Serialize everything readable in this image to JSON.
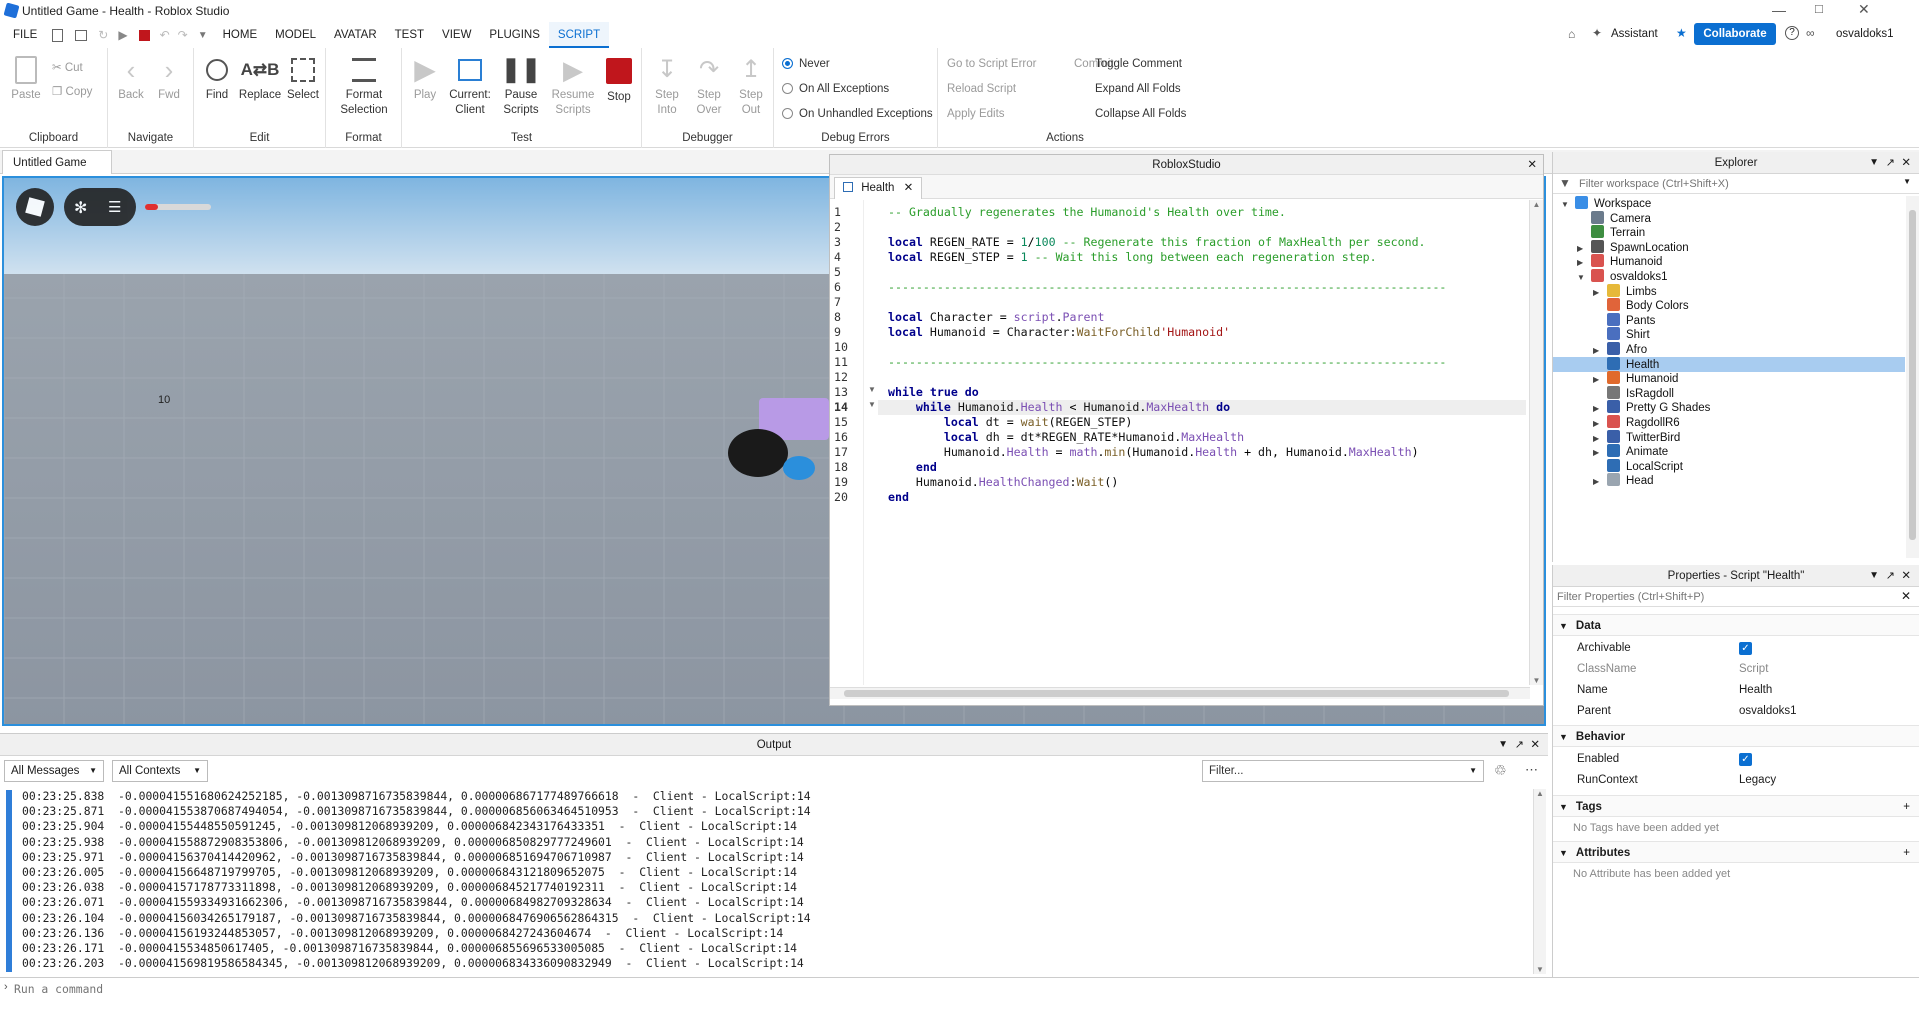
{
  "window": {
    "title": "Untitled Game - Health - Roblox Studio"
  },
  "menubar": {
    "items": [
      "FILE",
      "HOME",
      "MODEL",
      "AVATAR",
      "TEST",
      "VIEW",
      "PLUGINS",
      "SCRIPT"
    ],
    "active": "SCRIPT",
    "assistant": "Assistant",
    "collaborate": "Collaborate",
    "user": "osvaldoks1"
  },
  "ribbon": {
    "clipboard": {
      "label": "Clipboard",
      "paste": "Paste",
      "cut": "Cut",
      "copy": "Copy"
    },
    "navigate": {
      "label": "Navigate",
      "back": "Back",
      "fwd": "Fwd"
    },
    "edit": {
      "label": "Edit",
      "find": "Find",
      "replace": "Replace",
      "select": "Select"
    },
    "format": {
      "label": "Format",
      "format_selection_1": "Format",
      "format_selection_2": "Selection"
    },
    "test": {
      "label": "Test",
      "play": "Play",
      "current_1": "Current:",
      "current_2": "Client",
      "pause_1": "Pause",
      "pause_2": "Scripts",
      "resume_1": "Resume",
      "resume_2": "Scripts",
      "stop": "Stop"
    },
    "debugger": {
      "label": "Debugger",
      "step_into_1": "Step",
      "step_into_2": "Into",
      "step_over_1": "Step",
      "step_over_2": "Over",
      "step_out_1": "Step",
      "step_out_2": "Out"
    },
    "debug_errors": {
      "label": "Debug Errors",
      "never": "Never",
      "on_all": "On All Exceptions",
      "on_unhandled": "On Unhandled Exceptions",
      "selected": "Never"
    },
    "actions": {
      "label": "Actions",
      "go_to_error": "Go to Script Error",
      "commit": "Commit",
      "reload": "Reload Script",
      "apply": "Apply Edits",
      "toggle_comment": "Toggle Comment",
      "expand": "Expand All Folds",
      "collapse": "Collapse All Folds"
    }
  },
  "doc_tabs": {
    "game_tab": "Untitled Game"
  },
  "viewport": {
    "floating_number": "10",
    "health_fill": 0.2
  },
  "editor": {
    "window_title": "RobloxStudio",
    "tab": "Health",
    "lines": [
      "-- Gradually regenerates the Humanoid's Health over time.",
      "",
      "local REGEN_RATE = 1/100 -- Regenerate this fraction of MaxHealth per second.",
      "local REGEN_STEP = 1 -- Wait this long between each regeneration step.",
      "",
      "--------------------------------------------------------------------------------",
      "",
      "local Character = script.Parent",
      "local Humanoid = Character:WaitForChild'Humanoid'",
      "",
      "--------------------------------------------------------------------------------",
      "",
      "while true do",
      "    while Humanoid.Health < Humanoid.MaxHealth do",
      "        local dt = wait(REGEN_STEP)",
      "        local dh = dt*REGEN_RATE*Humanoid.MaxHealth",
      "        Humanoid.Health = math.min(Humanoid.Health + dh, Humanoid.MaxHealth)",
      "    end",
      "    Humanoid.HealthChanged:Wait()",
      "end"
    ],
    "current_line": 14
  },
  "explorer": {
    "title": "Explorer",
    "filter_placeholder": "Filter workspace (Ctrl+Shift+X)",
    "items": [
      {
        "label": "Workspace",
        "indent": 0,
        "arrow": "down",
        "icon": "#3a8ee6"
      },
      {
        "label": "Camera",
        "indent": 1,
        "arrow": "",
        "icon": "#6b7b8c"
      },
      {
        "label": "Terrain",
        "indent": 1,
        "arrow": "",
        "icon": "#3e8e41"
      },
      {
        "label": "SpawnLocation",
        "indent": 1,
        "arrow": "right",
        "icon": "#555555"
      },
      {
        "label": "Humanoid",
        "indent": 1,
        "arrow": "right",
        "icon": "#d9534f"
      },
      {
        "label": "osvaldoks1",
        "indent": 1,
        "arrow": "down",
        "icon": "#d9534f"
      },
      {
        "label": "Limbs",
        "indent": 2,
        "arrow": "right",
        "icon": "#e6b93a"
      },
      {
        "label": "Body Colors",
        "indent": 2,
        "arrow": "",
        "icon": "#e0643a"
      },
      {
        "label": "Pants",
        "indent": 2,
        "arrow": "",
        "icon": "#4a6fbf"
      },
      {
        "label": "Shirt",
        "indent": 2,
        "arrow": "",
        "icon": "#4a6fbf"
      },
      {
        "label": "Afro",
        "indent": 2,
        "arrow": "right",
        "icon": "#3a5fa8"
      },
      {
        "label": "Health",
        "indent": 2,
        "arrow": "",
        "icon": "#2e6db4"
      },
      {
        "label": "Humanoid",
        "indent": 2,
        "arrow": "right",
        "icon": "#e06a2c"
      },
      {
        "label": "IsRagdoll",
        "indent": 2,
        "arrow": "",
        "icon": "#777777"
      },
      {
        "label": "Pretty G Shades",
        "indent": 2,
        "arrow": "right",
        "icon": "#3a5fa8"
      },
      {
        "label": "RagdollR6",
        "indent": 2,
        "arrow": "right",
        "icon": "#d9534f"
      },
      {
        "label": "TwitterBird",
        "indent": 2,
        "arrow": "right",
        "icon": "#3a5fa8"
      },
      {
        "label": "Animate",
        "indent": 2,
        "arrow": "right",
        "icon": "#2e6db4"
      },
      {
        "label": "LocalScript",
        "indent": 2,
        "arrow": "",
        "icon": "#2e6db4"
      },
      {
        "label": "Head",
        "indent": 2,
        "arrow": "right",
        "icon": "#9aa5b0"
      }
    ],
    "selected": "Health"
  },
  "properties": {
    "title": "Properties - Script \"Health\"",
    "filter_placeholder": "Filter Properties (Ctrl+Shift+P)",
    "data_section": "Data",
    "archivable_label": "Archivable",
    "classname_label": "ClassName",
    "classname_value": "Script",
    "name_label": "Name",
    "name_value": "Health",
    "parent_label": "Parent",
    "parent_value": "osvaldoks1",
    "behavior_section": "Behavior",
    "enabled_label": "Enabled",
    "runcontext_label": "RunContext",
    "runcontext_value": "Legacy",
    "tags_section": "Tags",
    "tags_empty": "No Tags have been added yet",
    "attributes_section": "Attributes",
    "attributes_empty": "No Attribute has been added yet"
  },
  "output": {
    "title": "Output",
    "messages_filter": "All Messages",
    "contexts_filter": "All Contexts",
    "filter_placeholder": "Filter...",
    "lines": [
      "00:23:25.838  -0.0000415516806242521​85, -0.0013098716735839844, 0.00000686717748976661​8  -  Client - LocalScript:14",
      "00:23:25.871  -0.0000415538706874940​54, -0.0013098716735839844, 0.00000685606346451095​3  -  Client - LocalScript:14",
      "00:23:25.904  -0.000041554485505912​45, -0.0013098120689392​09, 0.00000684234317643335​1  -  Client - LocalScript:14",
      "00:23:25.938  -0.0000415588729083538​06, -0.0013098120689392​09, 0.00000685082977724960​1  -  Client - LocalScript:14",
      "00:23:25.971  -0.0000415637041442096​2, -0.0013098716735839844, 0.00000685169470671098​7  -  Client - LocalScript:14",
      "00:23:26.005  -0.0000415664871979970​5, -0.0013098120689392​09, 0.00000684312180965207​5  -  Client - LocalScript:14",
      "00:23:26.038  -0.0000415717877331189​8, -0.0013098120689392​09, 0.00000684521774019231​1  -  Client - LocalScript:14",
      "00:23:26.071  -0.0000415593349316623​06, -0.0013098716735839844, 0.00000684982709328634​  -  Client - LocalScript:14",
      "00:23:26.104  -0.0000415603426517918​7, -0.0013098716735839844, 0.00000684769065628643​15  -  Client - LocalScript:14",
      "00:23:26.136  -0.0000415619324485305​7, -0.0013098120689392​09, 0.00000684272436046​74  -  Client - LocalScript:14",
      "00:23:26.171  -0.0000415534850617405, -0.0013098716735839844, 0.00000685569653300508​5  -  Client - LocalScript:14",
      "00:23:26.203  -0.0000415698195865843​45, -0.0013098120689392​09, 0.00000683433609083294​9  -  Client - LocalScript:14"
    ]
  },
  "command_bar": {
    "placeholder": "Run a command"
  }
}
